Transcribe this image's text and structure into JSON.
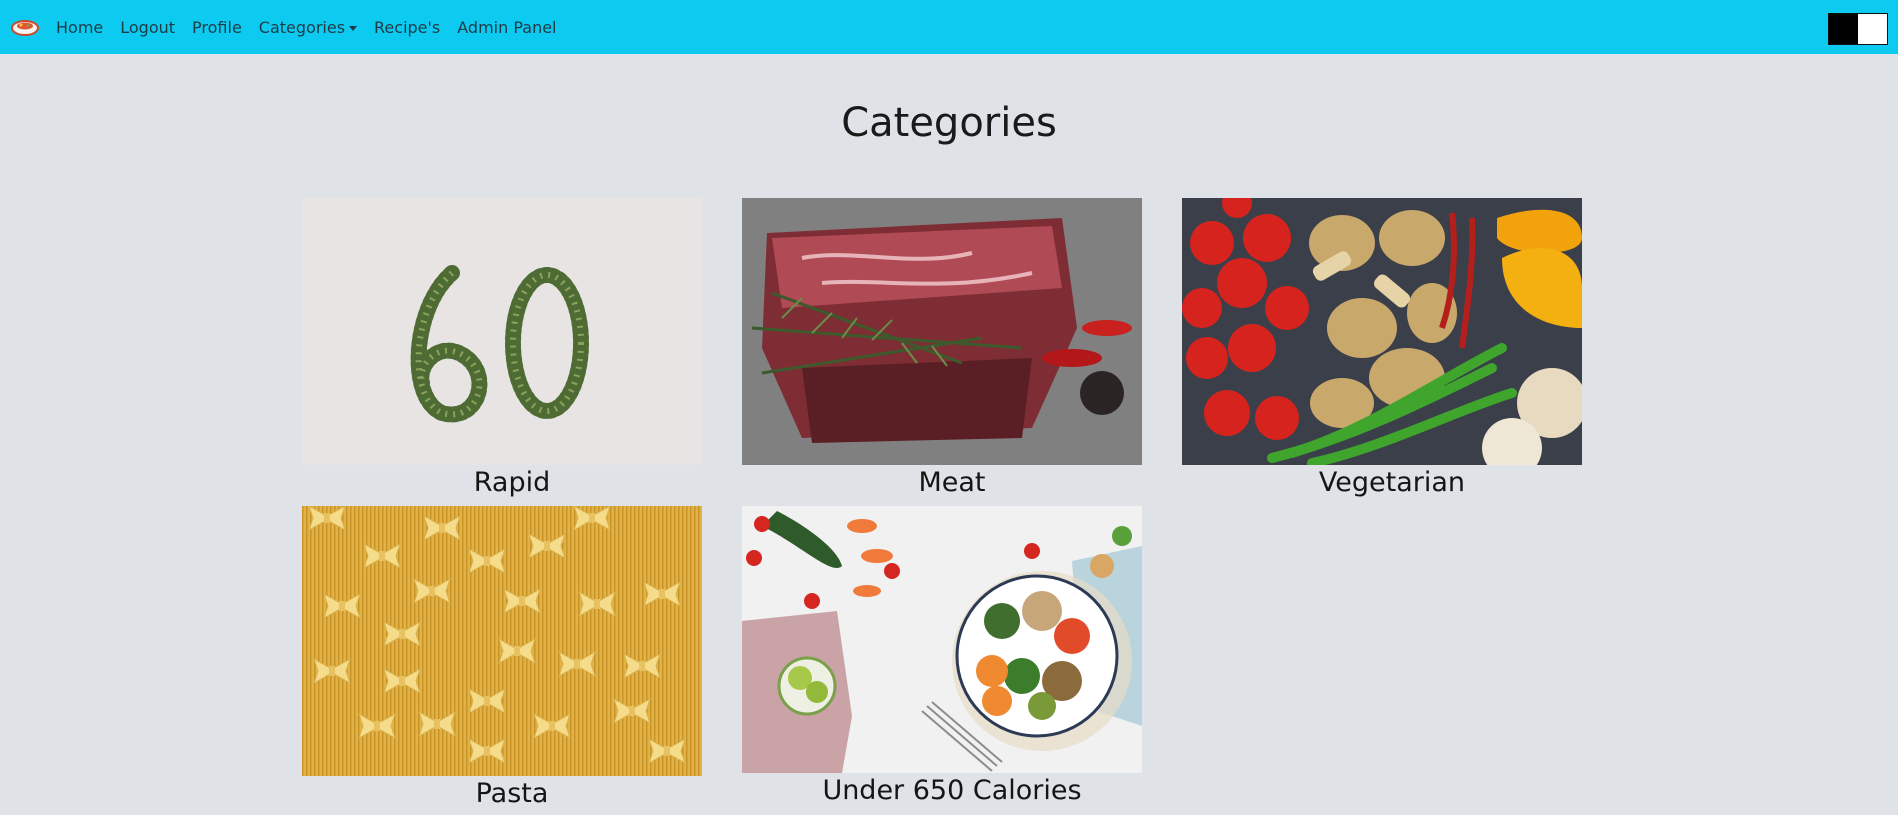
{
  "nav": {
    "links": [
      {
        "label": "Home"
      },
      {
        "label": "Logout"
      },
      {
        "label": "Profile"
      },
      {
        "label": "Categories"
      },
      {
        "label": "Recipe's"
      },
      {
        "label": "Admin Panel"
      }
    ]
  },
  "main": {
    "title": "Categories",
    "categories": [
      {
        "label": "Rapid"
      },
      {
        "label": "Meat"
      },
      {
        "label": "Vegetarian"
      },
      {
        "label": "Pasta"
      },
      {
        "label": "Under 650 Calories"
      }
    ]
  },
  "colors": {
    "navbar": "#0dcaf0",
    "background": "#dfe2e7"
  }
}
